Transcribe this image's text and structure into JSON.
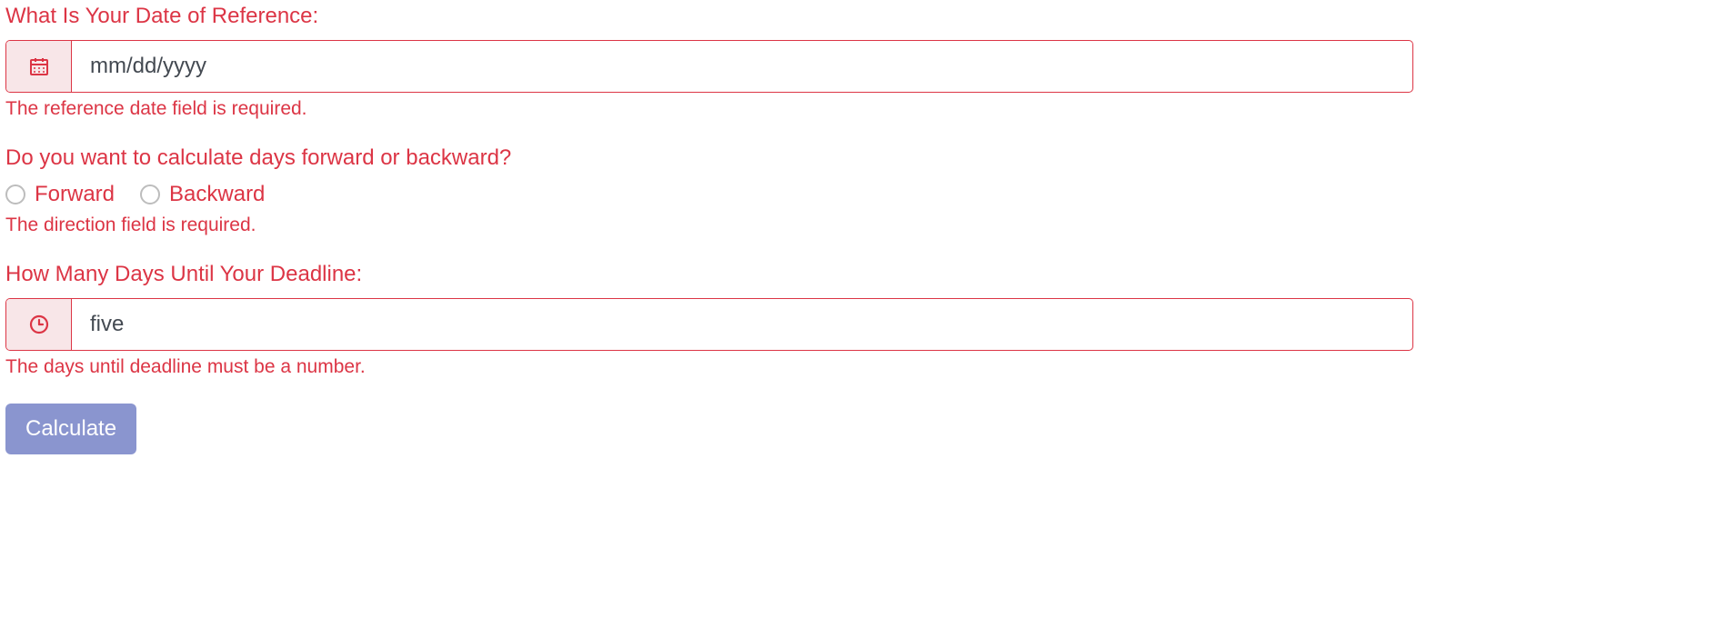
{
  "form": {
    "reference_date": {
      "label": "What Is Your Date of Reference:",
      "placeholder": "mm/dd/yyyy",
      "value": "",
      "error": "The reference date field is required."
    },
    "direction": {
      "label": "Do you want to calculate days forward or backward?",
      "options": {
        "forward": "Forward",
        "backward": "Backward"
      },
      "error": "The direction field is required."
    },
    "days_until": {
      "label": "How Many Days Until Your Deadline:",
      "value": "five",
      "error": "The days until deadline must be a number."
    },
    "submit_label": "Calculate"
  }
}
